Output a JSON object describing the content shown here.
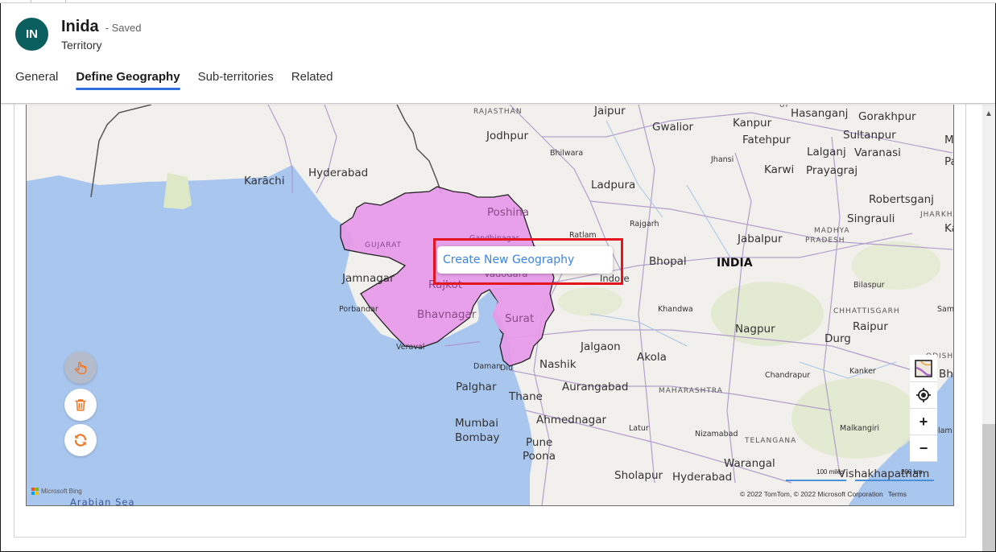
{
  "record": {
    "avatar_initials": "IN",
    "title": "Inida",
    "saved_status": "- Saved",
    "entity_type": "Territory"
  },
  "tabs": [
    {
      "label": "General",
      "active": false
    },
    {
      "label": "Define Geography",
      "active": true
    },
    {
      "label": "Sub-territories",
      "active": false
    },
    {
      "label": "Related",
      "active": false
    }
  ],
  "map": {
    "context_menu": {
      "item": "Create New Geography"
    },
    "tools": [
      {
        "name": "select-hand",
        "icon": "hand-pointer-icon",
        "selected": true
      },
      {
        "name": "delete",
        "icon": "trash-icon",
        "selected": false
      },
      {
        "name": "refresh",
        "icon": "refresh-icon",
        "selected": false
      }
    ],
    "controls": {
      "style_picker": "map-style-icon",
      "locate": "locate-icon",
      "zoom_in": "+",
      "zoom_out": "−"
    },
    "scale": {
      "miles": "100 miles",
      "km": "200 km"
    },
    "attribution": {
      "logo_text": "Microsoft Bing",
      "copyright": "© 2022 TomTom, © 2022 Microsoft Corporation",
      "terms": "Terms"
    },
    "colors": {
      "sea": "#a9c6ef",
      "land": "#f2f0ec",
      "selected_region": "#e79ae9",
      "highlight_box": "#e4151f",
      "menu_text": "#3c84e6",
      "tool_icon": "#f07623"
    },
    "labels": {
      "country": "INDIA",
      "sea": "Arabian Sea",
      "states": [
        "RAJASTHAN",
        "GUJARAT",
        "MADHYA",
        "PRADESH",
        "MAHARASHTRA",
        "CHHATTISGARH",
        "JHARKHAND",
        "TELANGANA",
        "ODISHA",
        "UP"
      ],
      "cities_large": [
        "Jaipur",
        "Gwalior",
        "Kanpur",
        "Hasanganj",
        "Gorakhpur",
        "Sultanpur",
        "Fatehpur",
        "Lalganj",
        "Varanasi",
        "Karwi",
        "Prayagraj",
        "Jodhpur",
        "Hyderabad",
        "Karāchi",
        "Ladpura",
        "Robertsganj",
        "Singrauli",
        "Jabalpur",
        "Bhopal",
        "Poshina",
        "Jamnagar",
        "Rajkot",
        "Bhavnagar",
        "Surat",
        "Nagpur",
        "Raipur",
        "Durg",
        "Jalgaon",
        "Akola",
        "Nashik",
        "Palghar",
        "Thane",
        "Aurangabad",
        "Ahmednagar",
        "Mumbai",
        "Bombay",
        "Pune",
        "Poona",
        "Sholapur",
        "Hyderabad ",
        "Warangal",
        "Vishakhapatnam",
        "Mu",
        "Pat",
        "Ka",
        "Bhu"
      ],
      "cities_small": [
        "Bhilwara",
        "Rajgarh",
        "Ratlam",
        "Gandhinagar",
        "Vadodara",
        "Indore",
        "Jhansi",
        "Porbandar",
        "Veraval",
        "Daman",
        "Diu",
        "Khandwa",
        "Bilaspur",
        "Sambalpur",
        "Kanker",
        "Chandrapur",
        "Malkangiri",
        "Srikakulam",
        "Latur",
        "Nizamabad"
      ]
    }
  }
}
